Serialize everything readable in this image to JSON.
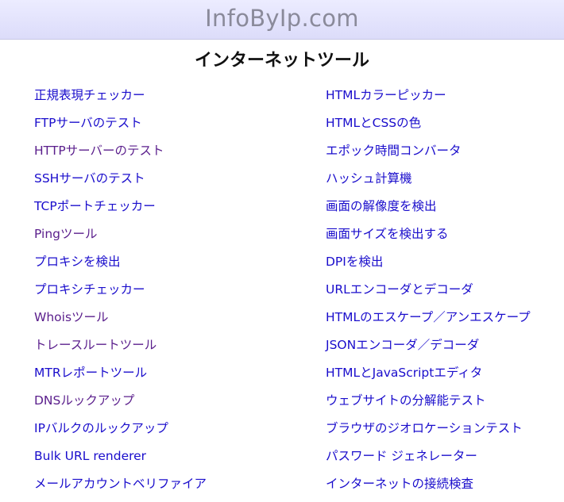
{
  "header": {
    "site_name": "InfoByIp.com"
  },
  "main": {
    "title": "インターネットツール",
    "left_links": [
      {
        "label": "正規表現チェッカー",
        "visited": false
      },
      {
        "label": "FTPサーバのテスト",
        "visited": false
      },
      {
        "label": "HTTPサーバーのテスト",
        "visited": true
      },
      {
        "label": "SSHサーバのテスト",
        "visited": false
      },
      {
        "label": "TCPポートチェッカー",
        "visited": false
      },
      {
        "label": "Pingツール",
        "visited": true
      },
      {
        "label": "プロキシを検出",
        "visited": false
      },
      {
        "label": "プロキシチェッカー",
        "visited": false
      },
      {
        "label": "Whoisツール",
        "visited": true
      },
      {
        "label": "トレースルートツール",
        "visited": true
      },
      {
        "label": "MTRレポートツール",
        "visited": false
      },
      {
        "label": "DNSルックアップ",
        "visited": true
      },
      {
        "label": "IPバルクのルックアップ",
        "visited": false
      },
      {
        "label": "Bulk URL renderer",
        "visited": false
      },
      {
        "label": "メールアカウントベリファイア",
        "visited": false
      }
    ],
    "right_links": [
      {
        "label": "HTMLカラーピッカー",
        "visited": false
      },
      {
        "label": "HTMLとCSSの色",
        "visited": false
      },
      {
        "label": "エポック時間コンバータ",
        "visited": false
      },
      {
        "label": "ハッシュ計算機",
        "visited": false
      },
      {
        "label": "画面の解像度を検出",
        "visited": false
      },
      {
        "label": "画面サイズを検出する",
        "visited": false
      },
      {
        "label": "DPIを検出",
        "visited": false
      },
      {
        "label": "URLエンコーダとデコーダ",
        "visited": false
      },
      {
        "label": "HTMLのエスケープ／アンエスケープ",
        "visited": false
      },
      {
        "label": "JSONエンコーダ／デコーダ",
        "visited": false
      },
      {
        "label": "HTMLとJavaScriptエディタ",
        "visited": false
      },
      {
        "label": "ウェブサイトの分解能テスト",
        "visited": false
      },
      {
        "label": "ブラウザのジオロケーションテスト",
        "visited": false
      },
      {
        "label": "パスワード ジェネレーター",
        "visited": false
      },
      {
        "label": "インターネットの接続検査",
        "visited": false
      }
    ]
  }
}
